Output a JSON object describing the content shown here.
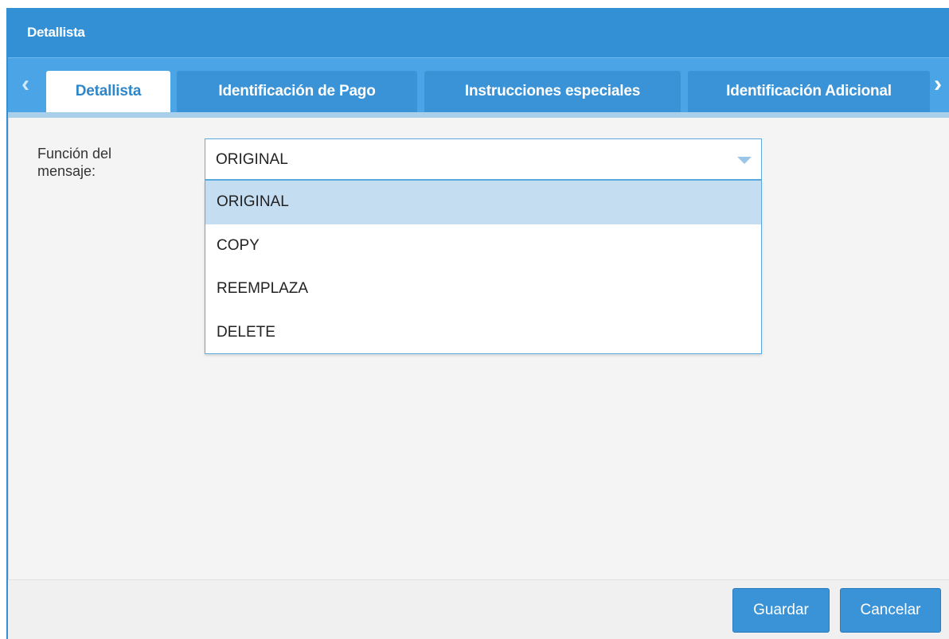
{
  "window": {
    "title": "Detallista"
  },
  "tabs": [
    {
      "label": "Detallista",
      "active": true
    },
    {
      "label": "Identificación de Pago",
      "active": false
    },
    {
      "label": "Instrucciones especiales",
      "active": false
    },
    {
      "label": "Identificación Adicional",
      "active": false
    }
  ],
  "tab_scroll": {
    "left_icon": "chevron-left-icon",
    "right_icon": "chevron-right-icon"
  },
  "form": {
    "message_function": {
      "label": "Función del mensaje:",
      "value": "ORIGINAL",
      "options": [
        "ORIGINAL",
        "COPY",
        "REEMPLAZA",
        "DELETE"
      ],
      "highlighted_option": "ORIGINAL"
    }
  },
  "footer": {
    "save_label": "Guardar",
    "cancel_label": "Cancelar"
  },
  "colors": {
    "header_blue": "#3490d4",
    "tab_bar_blue": "#4aa4e6",
    "active_tab_text": "#2f86c8",
    "selected_option_bg": "#c5ddf1",
    "button_blue": "#3a93d6"
  }
}
